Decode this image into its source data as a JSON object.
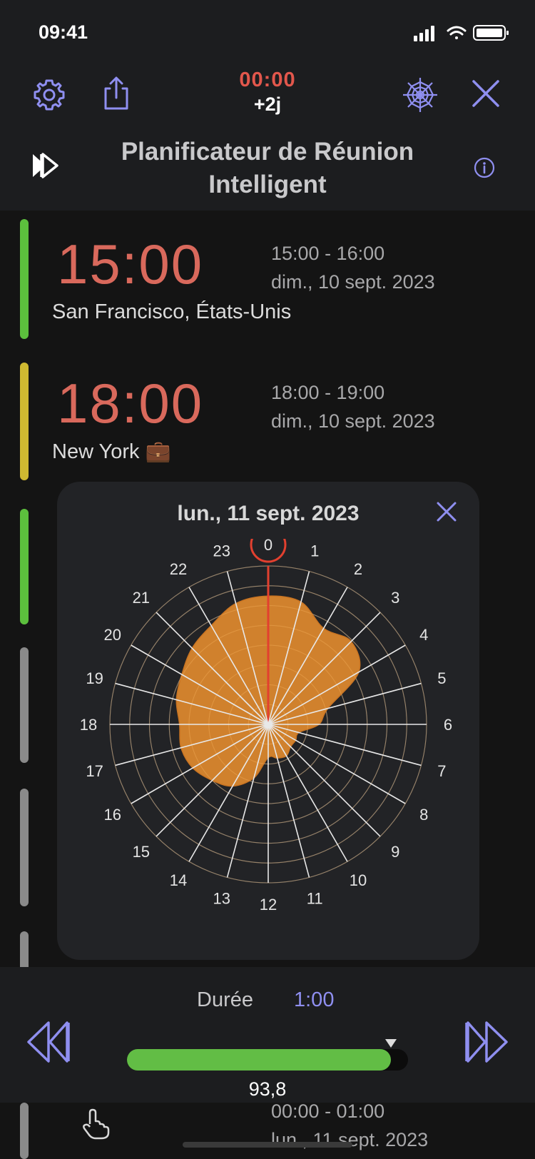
{
  "status_bar": {
    "time": "09:41"
  },
  "toolbar": {
    "timer": "00:00",
    "day_offset": "+2j",
    "title": "Planificateur de Réunion Intelligent",
    "icons": [
      "gear-icon",
      "share-icon",
      "web-icon",
      "close-icon",
      "fast-forward-icon",
      "info-icon"
    ]
  },
  "cities": [
    {
      "time": "15:00",
      "range": "15:00 - 16:00",
      "date": "dim., 10 sept. 2023",
      "name": "San Francisco, États-Unis",
      "color": "#5cbf3d"
    },
    {
      "time": "18:00",
      "range": "18:00 - 19:00",
      "date": "dim., 10 sept. 2023",
      "name": "New York 💼",
      "color": "#cfb931"
    }
  ],
  "peek_row": {
    "range": "00:00 - 01:00",
    "date": "lun., 11 sept. 2023"
  },
  "popup": {
    "title": "lun., 11 sept. 2023",
    "selected_hour": "0",
    "hour_labels": [
      "0",
      "1",
      "2",
      "3",
      "4",
      "5",
      "6",
      "7",
      "8",
      "9",
      "10",
      "11",
      "12",
      "13",
      "14",
      "15",
      "16",
      "17",
      "18",
      "19",
      "20",
      "21",
      "22",
      "23"
    ],
    "fill_color": "#e08a2e",
    "highlight_color": "#e2402f"
  },
  "chart_data": {
    "type": "radar",
    "title": "lun., 11 sept. 2023",
    "categories": [
      "0",
      "1",
      "2",
      "3",
      "4",
      "5",
      "6",
      "7",
      "8",
      "9",
      "10",
      "11",
      "12",
      "13",
      "14",
      "15",
      "16",
      "17",
      "18",
      "19",
      "20",
      "21",
      "22",
      "23"
    ],
    "values": [
      0.81,
      0.8,
      0.7,
      0.74,
      0.66,
      0.39,
      0.32,
      0.2,
      0.2,
      0.2,
      0.23,
      0.22,
      0.21,
      0.35,
      0.45,
      0.5,
      0.55,
      0.57,
      0.56,
      0.6,
      0.63,
      0.68,
      0.72,
      0.79
    ],
    "rlim": [
      0,
      1
    ],
    "rings": 8,
    "grid": true
  },
  "bottom": {
    "duration_label": "Durée",
    "duration_value": "1:00",
    "slider_value": "93,8",
    "slider_fraction": 0.938
  }
}
